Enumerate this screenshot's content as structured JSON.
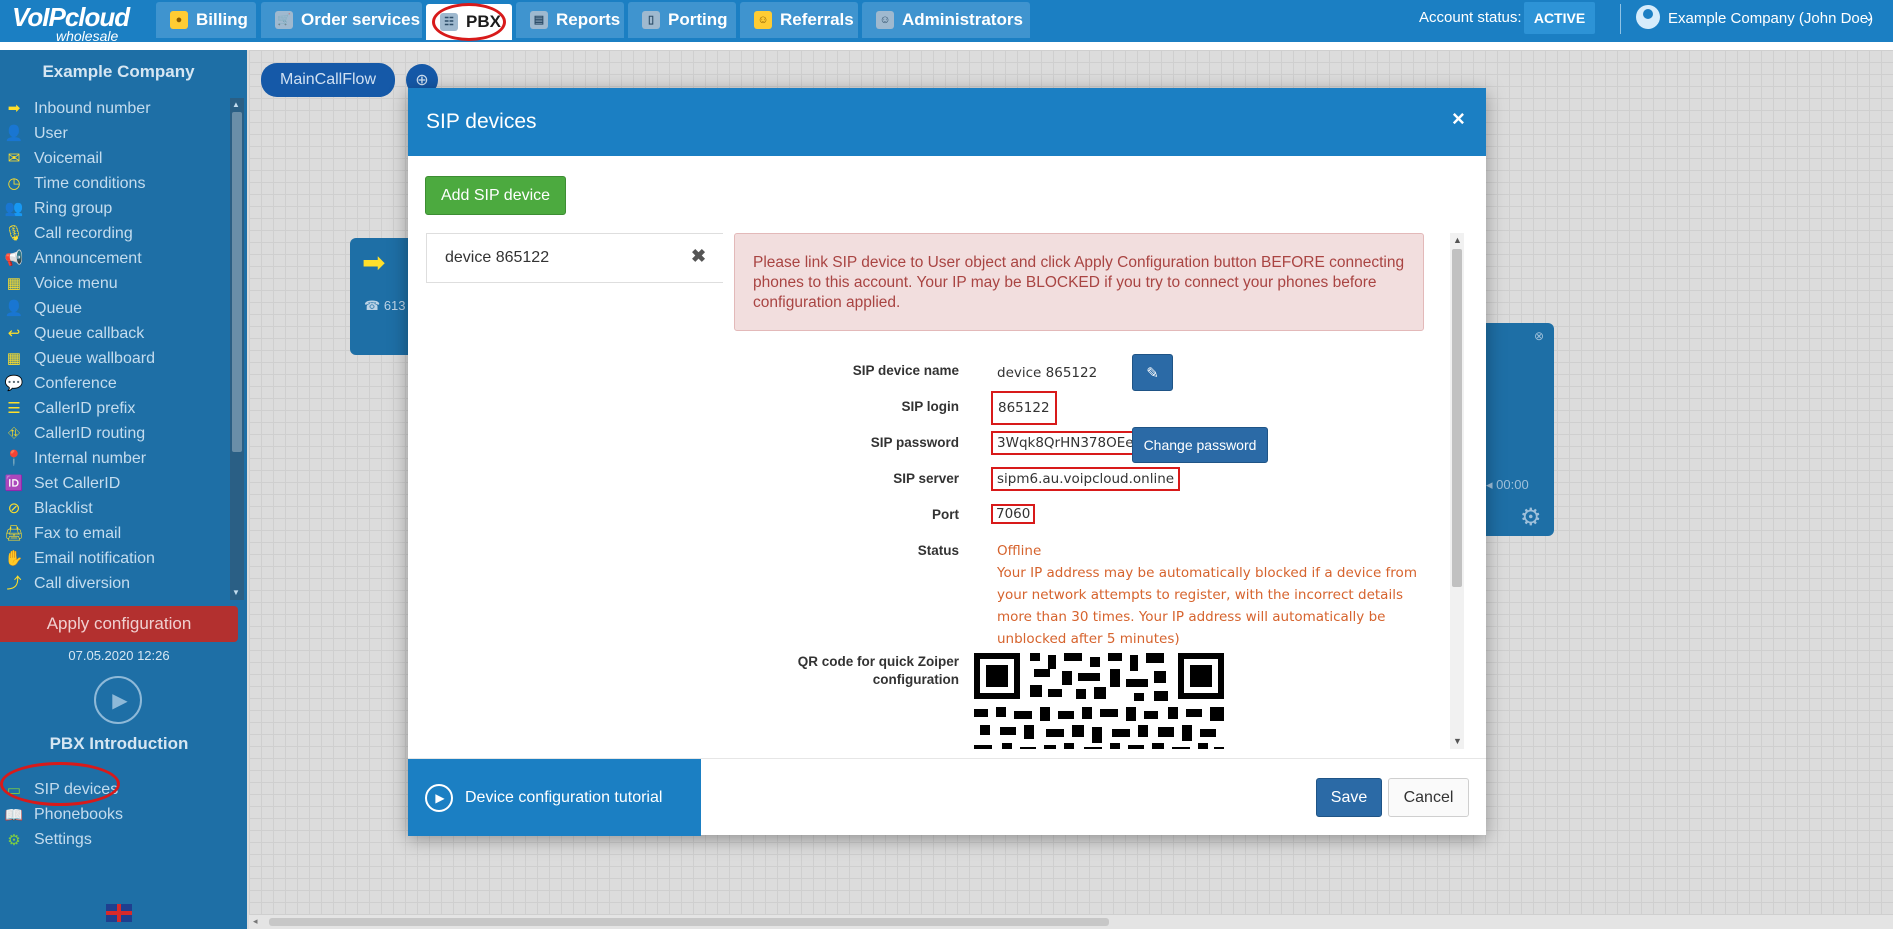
{
  "brand": {
    "logo_top": "VoIPcloud",
    "logo_bottom": "wholesale"
  },
  "nav": {
    "tabs": [
      {
        "label": "Billing",
        "icon": "coins-icon"
      },
      {
        "label": "Order services",
        "icon": "cart-icon"
      },
      {
        "label": "PBX",
        "icon": "pbx-icon"
      },
      {
        "label": "Reports",
        "icon": "report-icon"
      },
      {
        "label": "Porting",
        "icon": "phone-icon"
      },
      {
        "label": "Referrals",
        "icon": "person-icon"
      },
      {
        "label": "Administrators",
        "icon": "admin-icon"
      }
    ],
    "active_tab": "PBX",
    "account_status_label": "Account status:",
    "account_status_value": "ACTIVE",
    "user_name": "Example Company (John Doe)"
  },
  "sidebar": {
    "company": "Example Company",
    "items": [
      {
        "label": "Inbound number",
        "icon": "arrow-right-icon",
        "glyph": "➡"
      },
      {
        "label": "User",
        "icon": "user-icon",
        "glyph": "👤"
      },
      {
        "label": "Voicemail",
        "icon": "envelope-icon",
        "glyph": "✉"
      },
      {
        "label": "Time conditions",
        "icon": "clock-icon",
        "glyph": "◷"
      },
      {
        "label": "Ring group",
        "icon": "group-icon",
        "glyph": "👥"
      },
      {
        "label": "Call recording",
        "icon": "microphone-icon",
        "glyph": "🎙"
      },
      {
        "label": "Announcement",
        "icon": "megaphone-icon",
        "glyph": "📢"
      },
      {
        "label": "Voice menu",
        "icon": "grid-icon",
        "glyph": "▦"
      },
      {
        "label": "Queue",
        "icon": "user-plus-icon",
        "glyph": "👤"
      },
      {
        "label": "Queue callback",
        "icon": "reply-icon",
        "glyph": "↩"
      },
      {
        "label": "Queue wallboard",
        "icon": "table-icon",
        "glyph": "▦"
      },
      {
        "label": "Conference",
        "icon": "chat-icon",
        "glyph": "💬"
      },
      {
        "label": "CallerID prefix",
        "icon": "list-icon",
        "glyph": "☰"
      },
      {
        "label": "CallerID routing",
        "icon": "sitemap-icon",
        "glyph": "⛗"
      },
      {
        "label": "Internal number",
        "icon": "map-marker-icon",
        "glyph": "📍"
      },
      {
        "label": "Set CallerID",
        "icon": "id-card-icon",
        "glyph": "🆔"
      },
      {
        "label": "Blacklist",
        "icon": "ban-icon",
        "glyph": "⊘"
      },
      {
        "label": "Fax to email",
        "icon": "printer-icon",
        "glyph": "🖨"
      },
      {
        "label": "Email notification",
        "icon": "hand-icon",
        "glyph": "✋"
      },
      {
        "label": "Call diversion",
        "icon": "upload-icon",
        "glyph": "⤴"
      }
    ],
    "apply_label": "Apply configuration",
    "apply_date": "07.05.2020 12:26",
    "intro_label": "PBX Introduction",
    "bottom_items": [
      {
        "label": "SIP devices",
        "icon": "monitor-icon",
        "glyph": "▭"
      },
      {
        "label": "Phonebooks",
        "icon": "book-icon",
        "glyph": "📖"
      },
      {
        "label": "Settings",
        "icon": "gear-icon",
        "glyph": "⚙"
      }
    ]
  },
  "canvas": {
    "flow_tab": "MainCallFlow",
    "left_card_text": "613",
    "right_card_time": "00:00"
  },
  "modal": {
    "title": "SIP devices",
    "add_button": "Add SIP device",
    "devices": [
      {
        "name": "device 865122"
      }
    ],
    "alert": "Please link SIP device to User object and click Apply Configuration button BEFORE connecting phones to this account. Your IP may be BLOCKED if you try to connect your phones before configuration applied.",
    "fields": {
      "name_label": "SIP device name",
      "name_value": "device 865122",
      "login_label": "SIP login",
      "login_value": "865122",
      "password_label": "SIP password",
      "password_value": "3Wqk8QrHN378OEe8",
      "server_label": "SIP server",
      "server_value": "sipm6.au.voipcloud.online",
      "port_label": "Port",
      "port_value": "7060",
      "status_label": "Status",
      "status_value": "Offline",
      "status_note": "Your IP address may be automatically blocked if a device from your network attempts to register, with the incorrect details more than 30 times. Your IP address will automatically be unblocked after 5 minutes)",
      "qr_label": "QR code for quick Zoiper configuration"
    },
    "change_password": "Change password",
    "tutorial": "Device configuration tutorial",
    "save": "Save",
    "cancel": "Cancel"
  },
  "colors": {
    "primary": "#1b7fc3",
    "sidebar": "#1e6fa6",
    "success": "#4caa3f",
    "danger": "#b3302f",
    "highlight": "#d81a1a",
    "status_offline": "#d6632d"
  }
}
